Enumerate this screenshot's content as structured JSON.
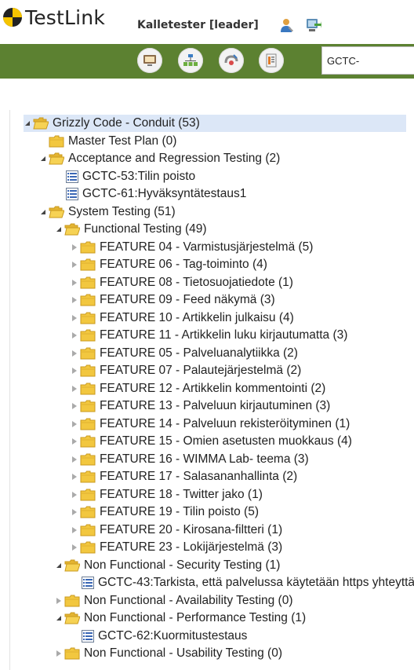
{
  "app": {
    "logo": "TestLink",
    "user": "Kalletester [leader]"
  },
  "search": {
    "value": "GCTC-"
  },
  "nav_icons": [
    "desktop-icon",
    "sitemap-icon",
    "test-execution-icon",
    "reports-icon"
  ],
  "colors": {
    "navbar": "#5c8131",
    "selection": "#dce7f7",
    "folder": "#f2c73f"
  },
  "tree": [
    {
      "label": "Grizzly Code - Conduit (53)",
      "type": "folder",
      "state": "open",
      "level": 0,
      "selected": true
    },
    {
      "label": "Master Test Plan (0)",
      "type": "folder",
      "state": "none",
      "level": 1
    },
    {
      "label": "Acceptance and Regression Testing (2)",
      "type": "folder",
      "state": "open",
      "level": 1
    },
    {
      "label": "GCTC-53:Tilin poisto",
      "type": "testcase",
      "level": 2
    },
    {
      "label": "GCTC-61:Hyväksyntätestaus1",
      "type": "testcase",
      "level": 2
    },
    {
      "label": "System Testing (51)",
      "type": "folder",
      "state": "open",
      "level": 1
    },
    {
      "label": "Functional Testing (49)",
      "type": "folder",
      "state": "open",
      "level": 2
    },
    {
      "label": "FEATURE 04 - Varmistusjärjestelmä (5)",
      "type": "folder",
      "state": "closed",
      "level": 3
    },
    {
      "label": "FEATURE 06 - Tag-toiminto (4)",
      "type": "folder",
      "state": "closed",
      "level": 3
    },
    {
      "label": "FEATURE 08 - Tietosuojatiedote (1)",
      "type": "folder",
      "state": "closed",
      "level": 3
    },
    {
      "label": "FEATURE 09 - Feed näkymä (3)",
      "type": "folder",
      "state": "closed",
      "level": 3
    },
    {
      "label": "FEATURE 10 - Artikkelin julkaisu (4)",
      "type": "folder",
      "state": "closed",
      "level": 3
    },
    {
      "label": "FEATURE 11 - Artikkelin luku kirjautumatta (3)",
      "type": "folder",
      "state": "closed",
      "level": 3
    },
    {
      "label": "FEATURE 05 - Palveluanalytiikka (2)",
      "type": "folder",
      "state": "closed",
      "level": 3
    },
    {
      "label": "FEATURE 07 - Palautejärjestelmä (2)",
      "type": "folder",
      "state": "closed",
      "level": 3
    },
    {
      "label": "FEATURE 12 - Artikkelin kommentointi (2)",
      "type": "folder",
      "state": "closed",
      "level": 3
    },
    {
      "label": "FEATURE 13 - Palveluun kirjautuminen (3)",
      "type": "folder",
      "state": "closed",
      "level": 3
    },
    {
      "label": "FEATURE 14 - Palveluun rekisteröityminen (1)",
      "type": "folder",
      "state": "closed",
      "level": 3
    },
    {
      "label": "FEATURE 15 - Omien asetusten muokkaus (4)",
      "type": "folder",
      "state": "closed",
      "level": 3
    },
    {
      "label": "FEATURE 16 - WIMMA Lab- teema (3)",
      "type": "folder",
      "state": "closed",
      "level": 3
    },
    {
      "label": "FEATURE 17 - Salasananhallinta (2)",
      "type": "folder",
      "state": "closed",
      "level": 3
    },
    {
      "label": "FEATURE 18 - Twitter jako (1)",
      "type": "folder",
      "state": "closed",
      "level": 3
    },
    {
      "label": "FEATURE 19 - Tilin poisto (5)",
      "type": "folder",
      "state": "closed",
      "level": 3
    },
    {
      "label": "FEATURE 20 - Kirosana-filtteri (1)",
      "type": "folder",
      "state": "closed",
      "level": 3
    },
    {
      "label": "FEATURE 23 - Lokijärjestelmä (3)",
      "type": "folder",
      "state": "closed",
      "level": 3
    },
    {
      "label": "Non Functional - Security Testing (1)",
      "type": "folder",
      "state": "open",
      "level": 2
    },
    {
      "label": "GCTC-43:Tarkista, että palvelussa käytetään https yhteyttä",
      "type": "testcase",
      "level": 3
    },
    {
      "label": "Non Functional - Availability Testing (0)",
      "type": "folder",
      "state": "closed",
      "level": 2
    },
    {
      "label": "Non Functional - Performance Testing (1)",
      "type": "folder",
      "state": "open",
      "level": 2
    },
    {
      "label": "GCTC-62:Kuormitustestaus",
      "type": "testcase",
      "level": 3
    },
    {
      "label": "Non Functional - Usability Testing (0)",
      "type": "folder",
      "state": "closed",
      "level": 2
    }
  ]
}
